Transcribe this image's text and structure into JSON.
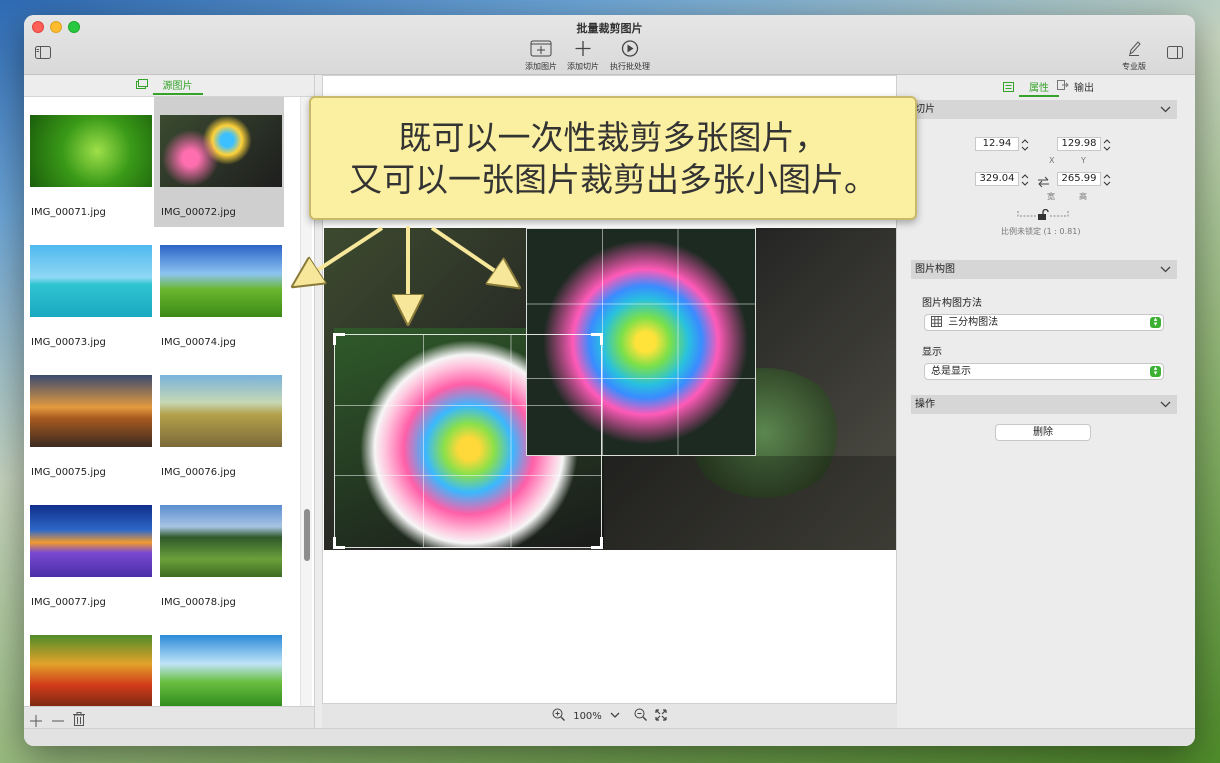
{
  "window": {
    "title": "批量裁剪图片"
  },
  "toolbar": {
    "add_image": "添加图片",
    "add_slice": "添加切片",
    "run_batch": "执行批处理",
    "pro_version": "专业版"
  },
  "left_panel": {
    "tab": "源图片",
    "thumbnails": [
      {
        "name": "IMG_00071.jpg"
      },
      {
        "name": "IMG_00072.jpg"
      },
      {
        "name": "IMG_00073.jpg"
      },
      {
        "name": "IMG_00074.jpg"
      },
      {
        "name": "IMG_00075.jpg"
      },
      {
        "name": "IMG_00076.jpg"
      },
      {
        "name": "IMG_00077.jpg"
      },
      {
        "name": "IMG_00078.jpg"
      }
    ],
    "selected": "IMG_00072.jpg"
  },
  "canvas_footer": {
    "zoom": "100%"
  },
  "right_panel": {
    "tabs": {
      "properties": "属性",
      "output": "输出"
    },
    "slice": {
      "header": "切片",
      "x": "12.94",
      "y": "129.98",
      "width": "329.04",
      "height": "265.99",
      "x_label": "X",
      "y_label": "Y",
      "width_label": "宽",
      "height_label": "高",
      "ratio_text": "比例未锁定 (1 : 0.81)"
    },
    "composition": {
      "header": "图片构图",
      "method_label": "图片构图方法",
      "method_value": "三分构图法",
      "display_label": "显示",
      "display_value": "总是显示"
    },
    "operations": {
      "header": "操作",
      "delete_button": "删除"
    }
  },
  "banner": {
    "line1": "既可以一次性裁剪多张图片，",
    "line2": "又可以一张图片裁剪出多张小图片。"
  },
  "colors": {
    "accent": "#35a32a",
    "banner_bg": "#fbf0a1",
    "banner_border": "#c9b96a"
  }
}
